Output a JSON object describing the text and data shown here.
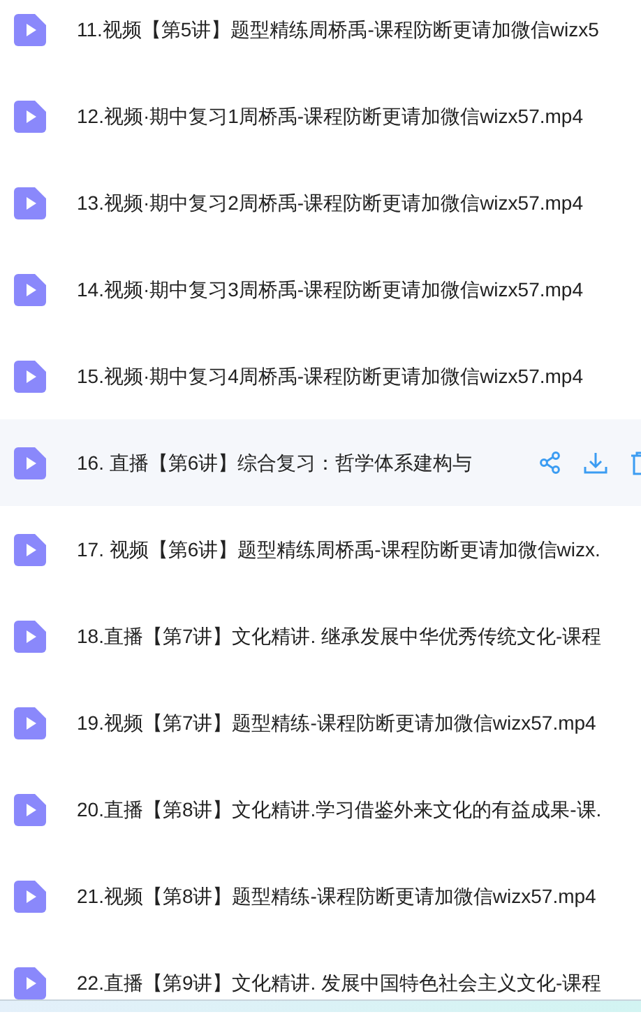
{
  "files": [
    {
      "name": "11.视频【第5讲】题型精练周桥禹-课程防断更请加微信wizx5",
      "highlighted": false
    },
    {
      "name": "12.视频·期中复习1周桥禹-课程防断更请加微信wizx57.mp4",
      "highlighted": false
    },
    {
      "name": "13.视频·期中复习2周桥禹-课程防断更请加微信wizx57.mp4",
      "highlighted": false
    },
    {
      "name": "14.视频·期中复习3周桥禹-课程防断更请加微信wizx57.mp4",
      "highlighted": false
    },
    {
      "name": "15.视频·期中复习4周桥禹-课程防断更请加微信wizx57.mp4",
      "highlighted": false
    },
    {
      "name": "16. 直播【第6讲】综合复习：哲学体系建构与",
      "highlighted": true
    },
    {
      "name": "17. 视频【第6讲】题型精练周桥禹-课程防断更请加微信wizx.",
      "highlighted": false
    },
    {
      "name": "18.直播【第7讲】文化精讲. 继承发展中华优秀传统文化-课程",
      "highlighted": false
    },
    {
      "name": "19.视频【第7讲】题型精练-课程防断更请加微信wizx57.mp4",
      "highlighted": false
    },
    {
      "name": "20.直播【第8讲】文化精讲.学习借鉴外来文化的有益成果-课.",
      "highlighted": false
    },
    {
      "name": "21.视频【第8讲】题型精练-课程防断更请加微信wizx57.mp4",
      "highlighted": false
    },
    {
      "name": "22.直播【第9讲】文化精讲. 发展中国特色社会主义文化-课程",
      "highlighted": false
    }
  ]
}
